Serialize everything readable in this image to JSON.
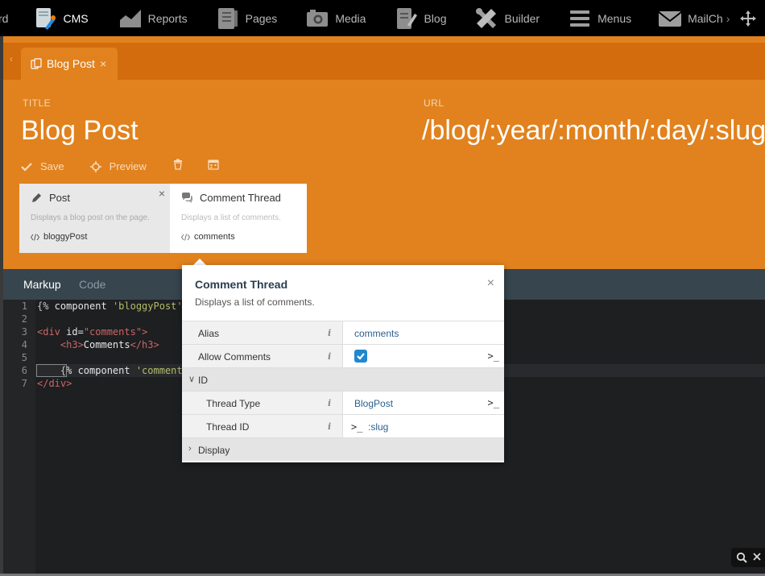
{
  "nav": {
    "items": [
      {
        "label": "rd",
        "icon": "dashboard-icon"
      },
      {
        "label": "CMS",
        "icon": "cms-icon",
        "active": true
      },
      {
        "label": "Reports",
        "icon": "reports-icon"
      },
      {
        "label": "Pages",
        "icon": "pages-icon"
      },
      {
        "label": "Media",
        "icon": "media-icon"
      },
      {
        "label": "Blog",
        "icon": "blog-icon"
      },
      {
        "label": "Builder",
        "icon": "builder-icon"
      },
      {
        "label": "Menus",
        "icon": "menus-icon"
      },
      {
        "label": "MailCh",
        "icon": "mail-icon"
      }
    ],
    "more_chevron": "›"
  },
  "tab": {
    "label": "Blog Post",
    "close": "×",
    "back": "‹"
  },
  "fields": {
    "title_label": "TITLE",
    "title_value": "Blog Post",
    "url_label": "URL",
    "url_value": "/blog/:year/:month/:day/:slug*"
  },
  "toolbar": {
    "save_label": "Save",
    "preview_label": "Preview"
  },
  "components": [
    {
      "title": "Post",
      "description": "Displays a blog post on the page.",
      "alias": "bloggyPost",
      "close": "×"
    },
    {
      "title": "Comment Thread",
      "description": "Displays a list of comments.",
      "alias": "comments"
    }
  ],
  "editor": {
    "tabs": [
      {
        "label": "Markup"
      },
      {
        "label": "Code"
      }
    ],
    "line_numbers": [
      "1",
      "2",
      "3",
      "4",
      "5",
      "6",
      "7"
    ],
    "lines": {
      "l1": {
        "a": "{%",
        "b": " component ",
        "c": "'bloggyPost'"
      },
      "l3": {
        "a": "<div",
        "b": " id=",
        "c": "\"comments\"",
        "d": ">"
      },
      "l4": {
        "a": "    <h3>",
        "b": "Comments",
        "c": "</h3>"
      },
      "l6": {
        "a": "    {",
        "b": "% component ",
        "c": "'comment"
      },
      "l7": {
        "a": "</div>"
      }
    }
  },
  "popup": {
    "title": "Comment Thread",
    "description": "Displays a list of comments.",
    "close": "×",
    "info_glyph": "i",
    "terminal_glyph": ">_",
    "properties": {
      "alias": {
        "label": "Alias",
        "value": "comments"
      },
      "allow_comments": {
        "label": "Allow Comments",
        "checked": true
      },
      "group_id": {
        "label": "ID",
        "chevron": "∨"
      },
      "thread_type": {
        "label": "Thread Type",
        "value": "BlogPost"
      },
      "thread_id": {
        "label": "Thread ID",
        "prefix": ">_",
        "value": ":slug"
      },
      "group_display": {
        "label": "Display",
        "chevron": "›"
      }
    }
  },
  "colors": {
    "accent": "#e1821e",
    "tabbar": "#d26c0c",
    "link": "#2a5f8f",
    "checkbox": "#1e88d0"
  }
}
